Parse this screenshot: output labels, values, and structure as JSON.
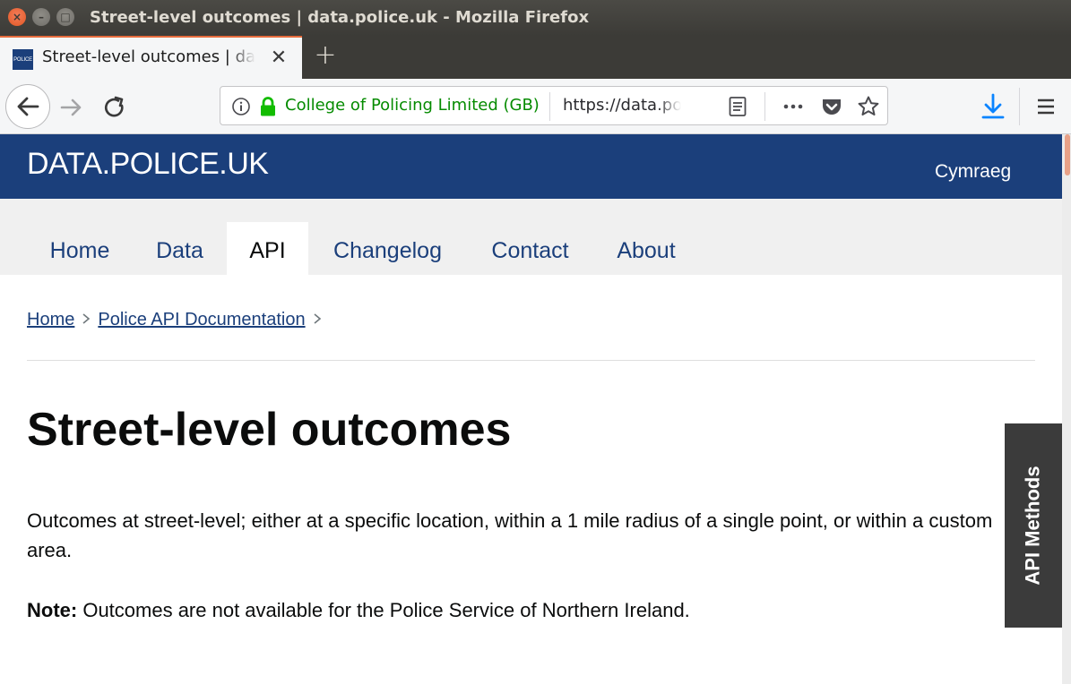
{
  "window": {
    "title": "Street-level outcomes | data.police.uk - Mozilla Firefox",
    "close_glyph": "×",
    "minimize_glyph": "–",
    "maximize_glyph": "□"
  },
  "tabs": [
    {
      "title": "Street-level outcomes | data.police.uk",
      "favicon_text": "POLICE",
      "close_glyph": "✕"
    }
  ],
  "new_tab_glyph": "+",
  "urlbar": {
    "identity": "College of Policing Limited (GB)",
    "url": "https://data.police.uk/docs/method/outcomes-at-location/"
  },
  "site": {
    "logo": "DATA.POLICE.UK",
    "language_link": "Cymraeg",
    "nav": [
      "Home",
      "Data",
      "API",
      "Changelog",
      "Contact",
      "About"
    ],
    "active_nav": "API"
  },
  "breadcrumb": {
    "items": [
      "Home",
      "Police API Documentation"
    ],
    "separator": ">"
  },
  "page": {
    "title": "Street-level outcomes",
    "intro": "Outcomes at street-level; either at a specific location, within a 1 mile radius of a single point, or within a custom area.",
    "note_label": "Note:",
    "note_text": " Outcomes are not available for the Police Service of Northern Ireland."
  },
  "api_methods_tab": {
    "label": "API Methods"
  },
  "colors": {
    "brand_blue": "#1b3f7b",
    "identity_green": "#058b00",
    "tab_accent": "#e66b3c",
    "download_blue": "#0a84ff"
  },
  "icons": {
    "back": "arrow-left-icon",
    "forward": "arrow-right-icon",
    "reload": "reload-icon",
    "info": "info-icon",
    "lock": "lock-icon",
    "reader": "reader-view-icon",
    "more": "more-icon",
    "pocket": "pocket-icon",
    "bookmark": "star-icon",
    "download": "download-icon",
    "menu": "hamburger-menu-icon"
  }
}
